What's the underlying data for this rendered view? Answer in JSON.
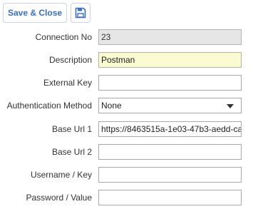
{
  "toolbar": {
    "save_close_label": "Save & Close",
    "save_icon": "floppy-disk-icon",
    "accent_color": "#3b6ec6"
  },
  "form": {
    "connection_no": {
      "label": "Connection No",
      "value": "23"
    },
    "description": {
      "label": "Description",
      "value": "Postman"
    },
    "external_key": {
      "label": "External Key",
      "value": ""
    },
    "authentication_method": {
      "label": "Authentication Method",
      "value": "None"
    },
    "base_url_1": {
      "label": "Base Url 1",
      "value": "https://8463515a-1e03-47b3-aedd-ca"
    },
    "base_url_2": {
      "label": "Base Url 2",
      "value": ""
    },
    "username_key": {
      "label": "Username / Key",
      "value": ""
    },
    "password_value": {
      "label": "Password / Value",
      "value": ""
    }
  }
}
